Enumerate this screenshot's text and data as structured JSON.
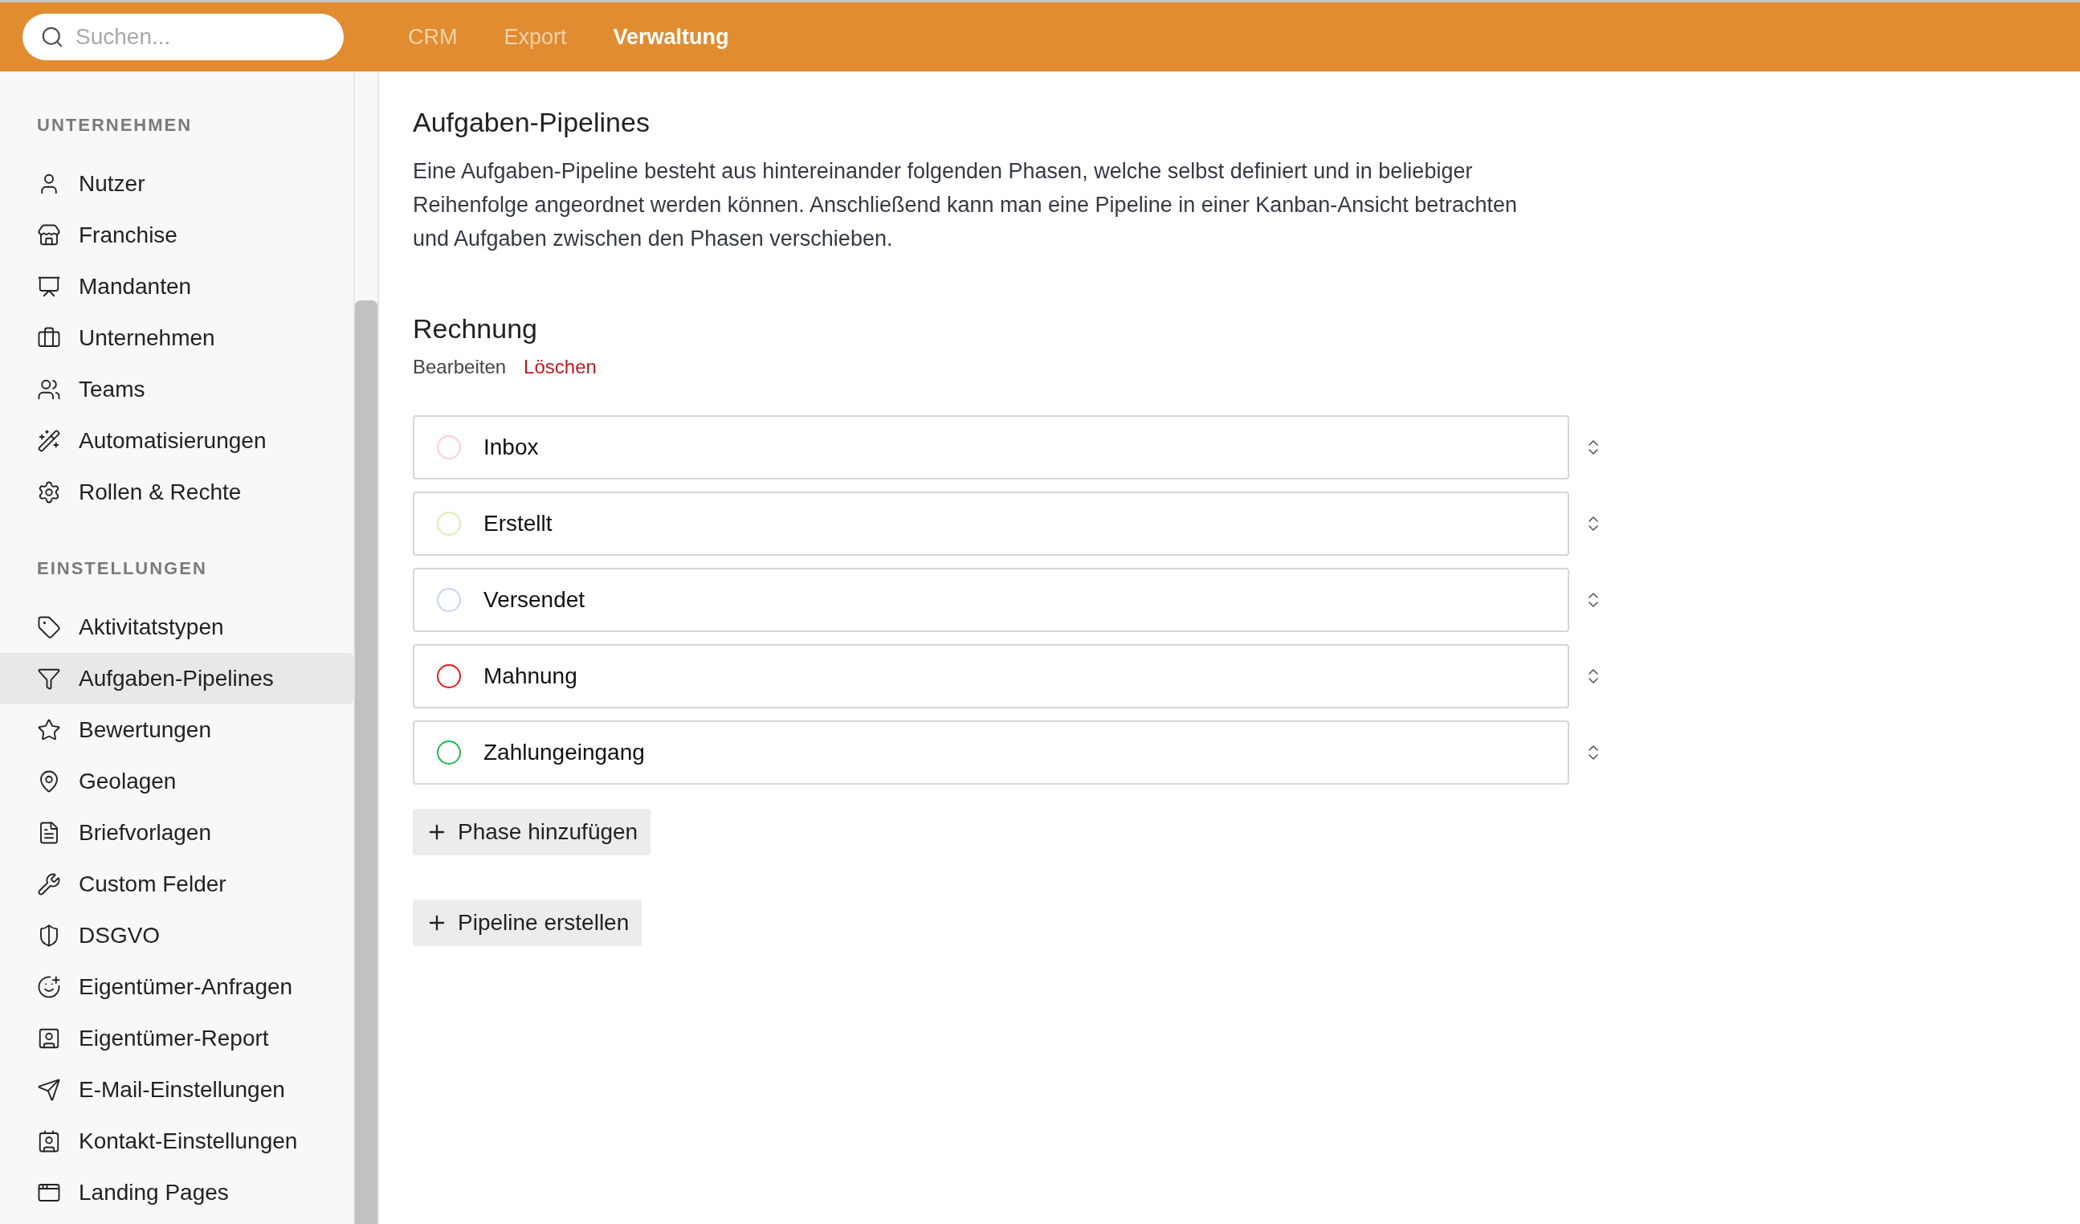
{
  "topbar": {
    "search": {
      "placeholder": "Suchen..."
    },
    "tabs": [
      {
        "label": "CRM",
        "selected": false
      },
      {
        "label": "Export",
        "selected": false
      },
      {
        "label": "Verwaltung",
        "selected": true
      }
    ]
  },
  "sidebar": {
    "sections": [
      {
        "heading": "UNTERNEHMEN",
        "items": [
          {
            "label": "Nutzer",
            "selected": false
          },
          {
            "label": "Franchise",
            "selected": false
          },
          {
            "label": "Mandanten",
            "selected": false
          },
          {
            "label": "Unternehmen",
            "selected": false
          },
          {
            "label": "Teams",
            "selected": false
          },
          {
            "label": "Automatisierungen",
            "selected": false
          },
          {
            "label": "Rollen & Rechte",
            "selected": false
          }
        ]
      },
      {
        "heading": "EINSTELLUNGEN",
        "items": [
          {
            "label": "Aktivitatstypen",
            "selected": false
          },
          {
            "label": "Aufgaben-Pipelines",
            "selected": true
          },
          {
            "label": "Bewertungen",
            "selected": false
          },
          {
            "label": "Geolagen",
            "selected": false
          },
          {
            "label": "Briefvorlagen",
            "selected": false
          },
          {
            "label": "Custom Felder",
            "selected": false
          },
          {
            "label": "DSGVO",
            "selected": false
          },
          {
            "label": "Eigentümer-Anfragen",
            "selected": false
          },
          {
            "label": "Eigentümer-Report",
            "selected": false
          },
          {
            "label": "E-Mail-Einstellungen",
            "selected": false
          },
          {
            "label": "Kontakt-Einstellungen",
            "selected": false
          },
          {
            "label": "Landing Pages",
            "selected": false
          }
        ]
      }
    ]
  },
  "main": {
    "title": "Aufgaben-Pipelines",
    "description": "Eine Aufgaben-Pipeline besteht aus hintereinander folgenden Phasen, welche selbst definiert und in beliebiger Reihenfolge angeordnet werden können. Anschließend kann man eine Pipeline in einer Kanban-Ansicht betrachten und Aufgaben zwischen den Phasen verschieben.",
    "pipeline": {
      "name": "Rechnung",
      "edit_label": "Bearbeiten",
      "delete_label": "Löschen",
      "phases": [
        {
          "label": "Inbox",
          "color": "#fbcfd0"
        },
        {
          "label": "Erstellt",
          "color": "#d6f0b0"
        },
        {
          "label": "Versendet",
          "color": "#c3d5f5"
        },
        {
          "label": "Mahnung",
          "color": "#f01818"
        },
        {
          "label": "Zahlungeingang",
          "color": "#1fb84f"
        }
      ],
      "add_phase_label": "Phase hinzufügen"
    },
    "create_pipeline_label": "Pipeline erstellen"
  }
}
